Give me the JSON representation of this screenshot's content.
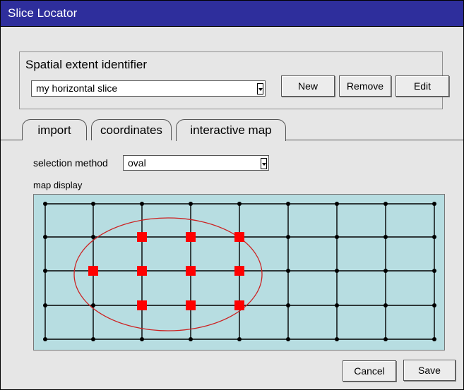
{
  "window": {
    "title": "Slice Locator"
  },
  "spatial_extent": {
    "label": "Spatial extent identifier",
    "selected": "my horizontal slice",
    "buttons": {
      "new": "New",
      "remove": "Remove",
      "edit": "Edit"
    }
  },
  "tabs": [
    {
      "label": "import",
      "active": false
    },
    {
      "label": "coordinates",
      "active": false
    },
    {
      "label": "interactive map",
      "active": true
    }
  ],
  "selection_method": {
    "label": "selection method",
    "value": "oval"
  },
  "map_display": {
    "label": "map display",
    "grid_columns": 9,
    "grid_rows": 5,
    "selected_cells": [
      [
        2,
        1
      ],
      [
        3,
        1
      ],
      [
        4,
        1
      ],
      [
        1,
        2
      ],
      [
        2,
        2
      ],
      [
        3,
        2
      ],
      [
        4,
        2
      ],
      [
        2,
        3
      ],
      [
        3,
        3
      ],
      [
        4,
        3
      ]
    ],
    "colors": {
      "background": "#b7dde1",
      "grid": "#000000",
      "oval": "#cc2222",
      "selected": "#ff0000"
    }
  },
  "footer": {
    "cancel": "Cancel",
    "save": "Save"
  }
}
